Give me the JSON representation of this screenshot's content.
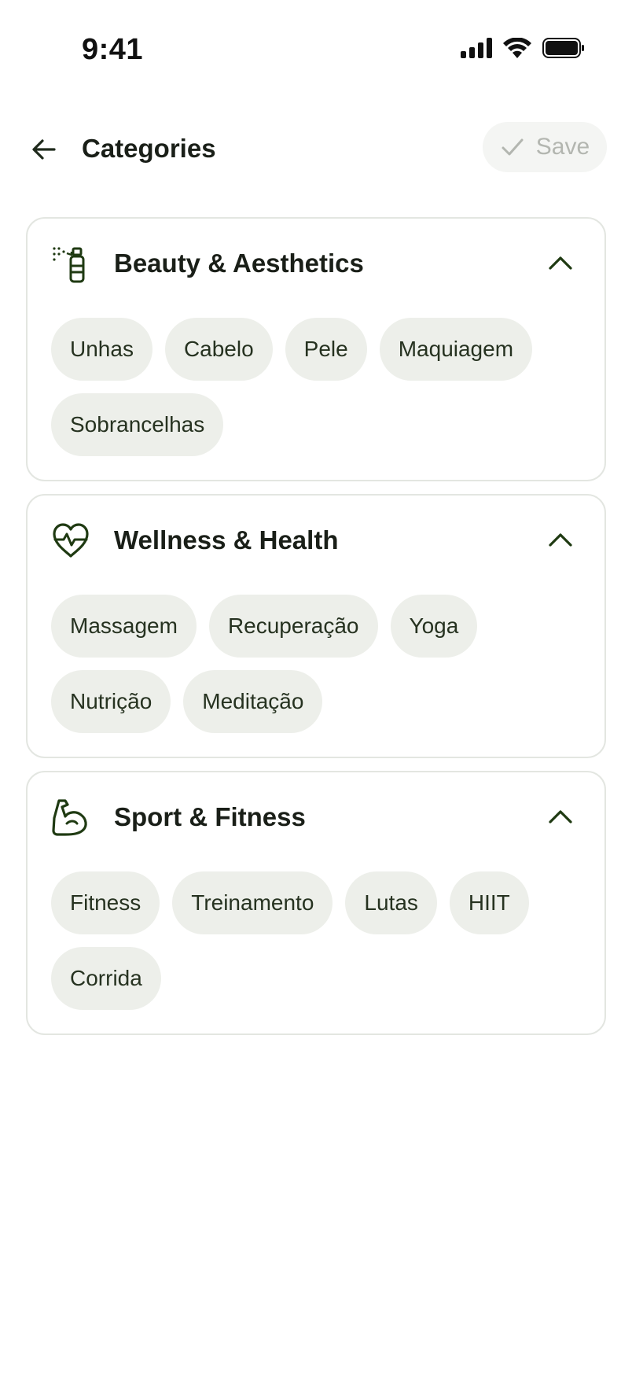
{
  "status_bar": {
    "time": "9:41",
    "icons": [
      "signal-icon",
      "wifi-icon",
      "battery-icon"
    ]
  },
  "header": {
    "title": "Categories",
    "save_label": "Save",
    "back_icon": "arrow-left-icon",
    "save_icon": "check-icon"
  },
  "colors": {
    "accent": "#1f3a12",
    "chip_bg": "#edefea",
    "card_border": "#e3e6e1",
    "disabled_text": "#b3b6b0"
  },
  "categories": [
    {
      "title": "Beauty & Aesthetics",
      "icon": "spray-bottle-icon",
      "expanded": true,
      "items": [
        "Unhas",
        "Cabelo",
        "Pele",
        "Maquiagem",
        "Sobrancelhas"
      ]
    },
    {
      "title": "Wellness & Health",
      "icon": "heart-pulse-icon",
      "expanded": true,
      "items": [
        "Massagem",
        "Recuperação",
        "Yoga",
        "Nutrição",
        "Meditação"
      ]
    },
    {
      "title": "Sport & Fitness",
      "icon": "flexed-arm-icon",
      "expanded": true,
      "items": [
        "Fitness",
        "Treinamento",
        "Lutas",
        "HIIT",
        "Corrida"
      ]
    }
  ]
}
